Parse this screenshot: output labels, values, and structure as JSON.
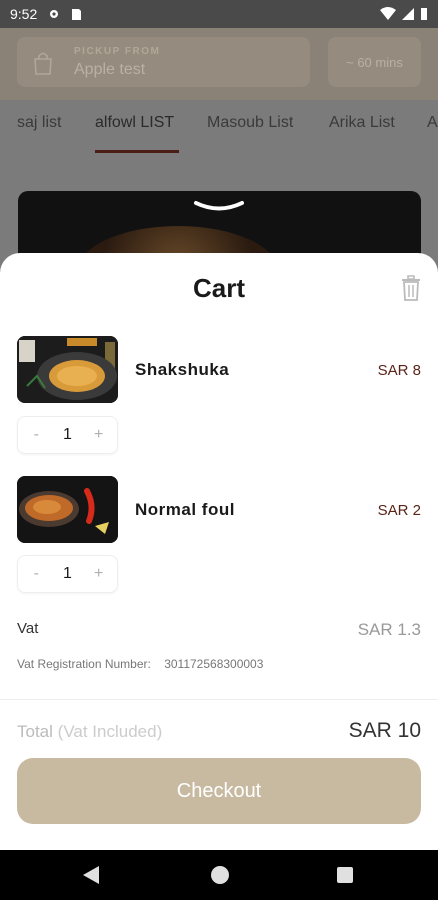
{
  "status_bar": {
    "time": "9:52"
  },
  "pickup": {
    "label": "PICKUP FROM",
    "store": "Apple test",
    "eta": "~ 60 mins"
  },
  "tabs": [
    {
      "label": "saj list"
    },
    {
      "label": "alfowl LIST"
    },
    {
      "label": "Masoub List"
    },
    {
      "label": "Arika List"
    },
    {
      "label": "A"
    }
  ],
  "cart": {
    "title": "Cart",
    "items": [
      {
        "name": "Shakshuka",
        "price": "SAR 8",
        "qty": "1",
        "minus": "-",
        "plus": "+"
      },
      {
        "name": "Normal foul",
        "price": "SAR 2",
        "qty": "1",
        "minus": "-",
        "plus": "+"
      }
    ],
    "vat_label": "Vat",
    "vat_value": "SAR 1.3",
    "vat_reg_label": "Vat Registration Number:",
    "vat_reg_number": "301172568300003",
    "total_label": "Total",
    "total_sub": "(Vat Included)",
    "total_value": "SAR 10",
    "checkout_label": "Checkout"
  },
  "colors": {
    "accent": "#c8baa1",
    "price": "#5a2418",
    "tab_underline": "#4a1e16"
  }
}
